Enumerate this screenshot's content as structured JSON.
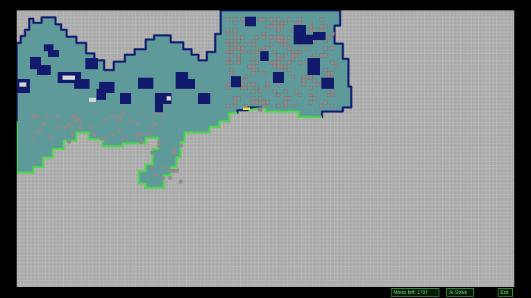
{
  "game": {
    "name": "minesweeper",
    "colors": {
      "background": "#000000",
      "unrevealed": "#a9a9a9",
      "grid_line": "#c4c4c4",
      "revealed": "#5e9a9a",
      "mine_cell": "#8b8b8b",
      "border_dark": "#121a6e",
      "border_frontier": "#4fd64f",
      "highlight": "#e8e04a"
    },
    "board": {
      "cols": 138,
      "rows": 77
    }
  },
  "status": {
    "mines_left_label": "Mines left: 1707",
    "ai_solve_label": "AI Solve",
    "exit_label": "Exit"
  }
}
